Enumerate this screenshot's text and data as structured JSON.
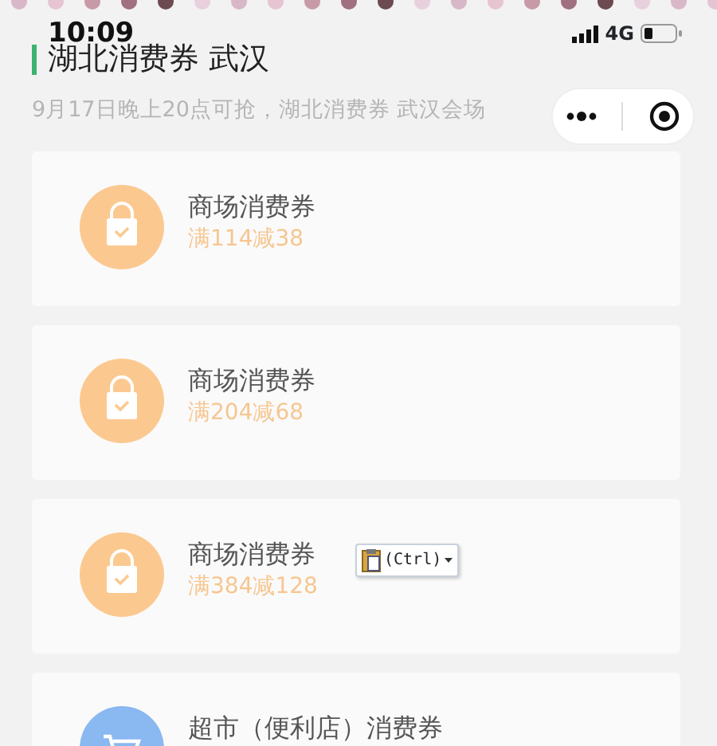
{
  "status_bar": {
    "time": "10:09",
    "network": "4G"
  },
  "header": {
    "title": "湖北消费券 武汉",
    "subtitle": "9月17日晚上20点可抢，湖北消费券 武汉会场"
  },
  "coupons": [
    {
      "kind": "mall",
      "name": "商场消费券",
      "amount": "满114减38"
    },
    {
      "kind": "mall",
      "name": "商场消费券",
      "amount": "满204减68"
    },
    {
      "kind": "mall",
      "name": "商场消费券",
      "amount": "满384减128"
    },
    {
      "kind": "supermarket",
      "name": "超市（便利店）消费券"
    }
  ],
  "paste_popup": {
    "label": "(Ctrl)"
  }
}
